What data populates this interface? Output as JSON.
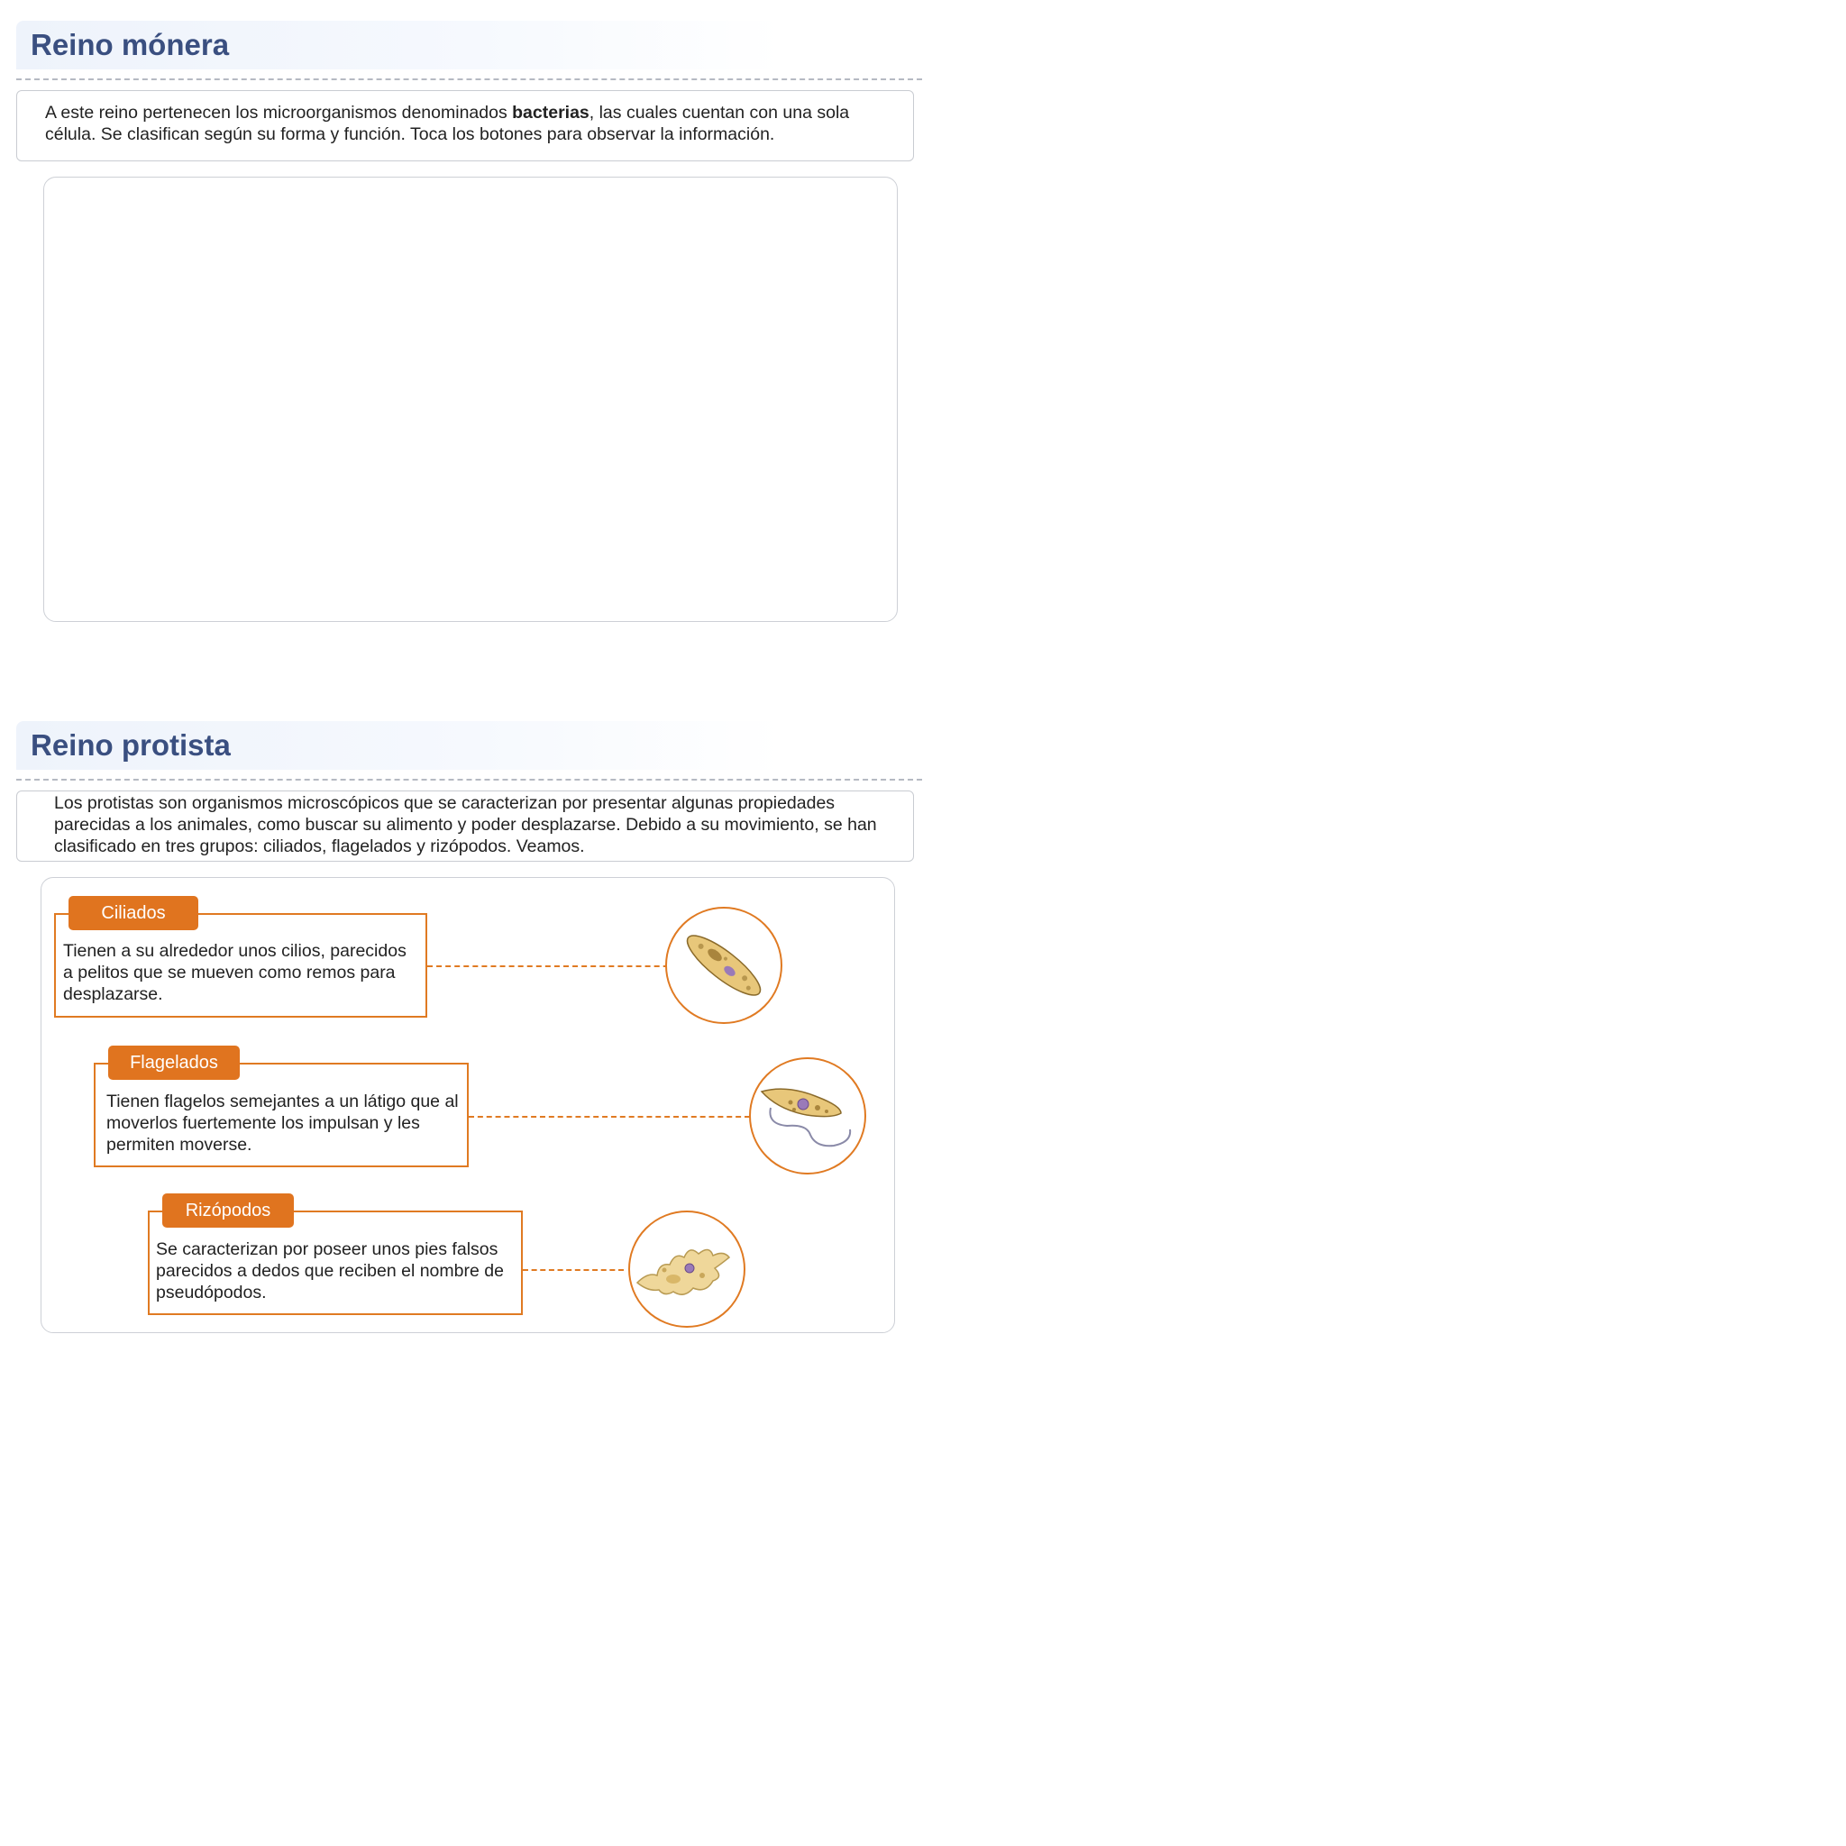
{
  "monera": {
    "title": "Reino mónera",
    "intro_before": "A este reino pertenecen los microorganismos denominados ",
    "intro_bold": "bacterias",
    "intro_after": ", las cuales cuentan con una sola célula. Se clasifican según su forma y función. Toca los botones para observar la información."
  },
  "protista": {
    "title": "Reino protista",
    "intro": "Los protistas son organismos microscópicos que se caracterizan por presentar algunas propiedades parecidas a los animales, como buscar su alimento y poder desplazarse. Debido a su movimiento, se han clasificado en tres grupos: ciliados, flagelados y rizópodos. Veamos.",
    "groups": [
      {
        "label": "Ciliados",
        "text": "Tienen a su alrededor unos cilios, parecidos a pelitos que se mueven como remos para desplazarse.",
        "icon": "ciliate-icon"
      },
      {
        "label": "Flagelados",
        "text": "Tienen flagelos semejantes a un látigo que al moverlos fuertemente los impulsan y les permiten moverse.",
        "icon": "flagellate-icon"
      },
      {
        "label": "Rizópodos",
        "text": "Se caracterizan por poseer unos pies falsos parecidos a dedos que reciben el nombre de pseudópodos.",
        "icon": "amoeba-icon"
      }
    ]
  },
  "colors": {
    "title": "#3a4f80",
    "accent_orange": "#e0741f",
    "organism_fill": "#e8c77a"
  }
}
